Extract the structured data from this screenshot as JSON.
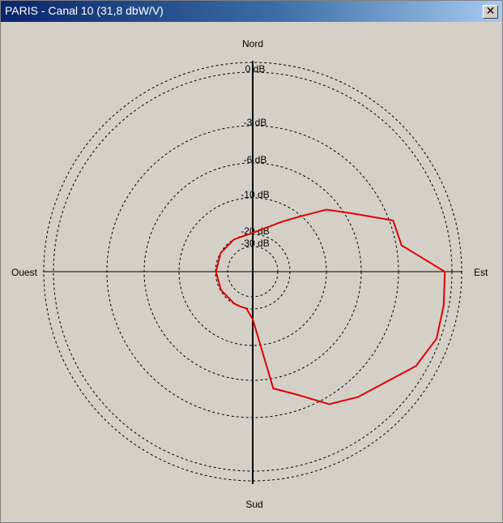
{
  "window": {
    "title": "PARIS - Canal 10 (31,8 dbW/V)",
    "close_icon": "close-icon",
    "close_glyph": "✕"
  },
  "colors": {
    "background": "#d4d0c8",
    "pattern": "#e00000",
    "axes": "#000000",
    "titlebar_start": "#0a246a",
    "titlebar_end": "#a6caf0"
  },
  "chart_data": {
    "type": "polar",
    "title": "",
    "directions": {
      "north": "Nord",
      "south": "Sud",
      "east": "Est",
      "west": "Ouest"
    },
    "radial_unit": "dB",
    "rings": [
      {
        "label": "0 dB",
        "db": 0
      },
      {
        "label": "-3 dB",
        "db": -3
      },
      {
        "label": "-6 dB",
        "db": -6
      },
      {
        "label": "-10 dB",
        "db": -10
      },
      {
        "label": "-20 dB",
        "db": -20
      },
      {
        "label": "-30 dB",
        "db": -30
      }
    ],
    "grid": true,
    "series": [
      {
        "color": "#e00000",
        "points": [
          {
            "azimuth_deg": 0,
            "db": -19.6
          },
          {
            "azimuth_deg": 30,
            "db": -14.5
          },
          {
            "azimuth_deg": 40,
            "db": -10.6
          },
          {
            "azimuth_deg": 50,
            "db": -7.4
          },
          {
            "azimuth_deg": 60,
            "db": -5.4
          },
          {
            "azimuth_deg": 70,
            "db": -2.8
          },
          {
            "azimuth_deg": 80,
            "db": -2.7
          },
          {
            "azimuth_deg": 90,
            "db": -0.4
          },
          {
            "azimuth_deg": 100,
            "db": -0.3
          },
          {
            "azimuth_deg": 110,
            "db": -0.2
          },
          {
            "azimuth_deg": 120,
            "db": -0.6
          },
          {
            "azimuth_deg": 130,
            "db": -1.5
          },
          {
            "azimuth_deg": 140,
            "db": -2.0
          },
          {
            "azimuth_deg": 150,
            "db": -2.6
          },
          {
            "azimuth_deg": 160,
            "db": -4.2
          },
          {
            "azimuth_deg": 170,
            "db": -5.2
          },
          {
            "azimuth_deg": 180,
            "db": -17.2
          },
          {
            "azimuth_deg": 190,
            "db": -20.1
          },
          {
            "azimuth_deg": 200,
            "db": -20.2
          },
          {
            "azimuth_deg": 210,
            "db": -20.3
          },
          {
            "azimuth_deg": 240,
            "db": -20.5
          },
          {
            "azimuth_deg": 270,
            "db": -20.4
          },
          {
            "azimuth_deg": 300,
            "db": -20.2
          },
          {
            "azimuth_deg": 330,
            "db": -20.0
          },
          {
            "azimuth_deg": 360,
            "db": -19.6
          }
        ]
      }
    ]
  }
}
